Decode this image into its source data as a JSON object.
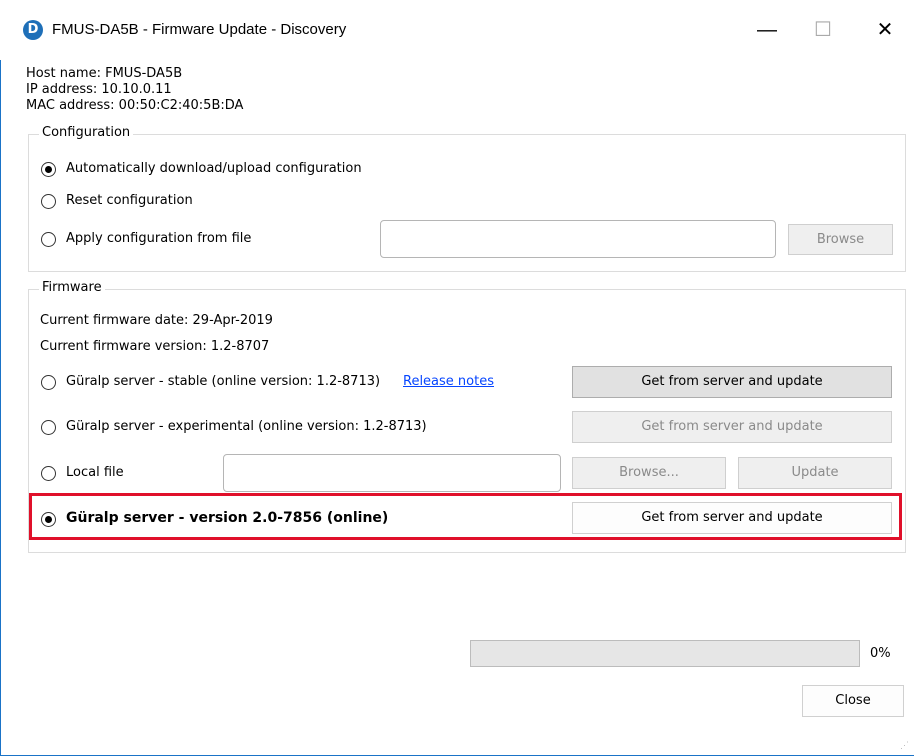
{
  "window": {
    "app_icon_letter": "D",
    "title": "FMUS-DA5B - Firmware Update - Discovery",
    "minimize": "—",
    "maximize": "☐",
    "close": "✕"
  },
  "host": {
    "host_name": "Host name:  FMUS-DA5B",
    "ip_address": "IP address:  10.10.0.11",
    "mac_address": "MAC address:  00:50:C2:40:5B:DA"
  },
  "configuration": {
    "legend": "Configuration",
    "options": [
      {
        "label": "Automatically download/upload configuration",
        "selected": true
      },
      {
        "label": "Reset configuration",
        "selected": false
      },
      {
        "label": "Apply configuration from file",
        "selected": false
      }
    ],
    "file_path": "",
    "browse_label": "Browse"
  },
  "firmware": {
    "legend": "Firmware",
    "current_date": "Current firmware date: 29-Apr-2019",
    "current_version": "Current firmware version: 1.2-8707",
    "stable": {
      "label": "Güralp server - stable (online version: 1.2-8713)",
      "release_notes": "Release notes",
      "button": "Get from server and update"
    },
    "experimental": {
      "label": "Güralp server - experimental (online version: 1.2-8713)",
      "button": "Get from server and update"
    },
    "local": {
      "label": "Local file",
      "file_path": "",
      "browse_button": "Browse...",
      "update_button": "Update"
    },
    "online": {
      "label": "Güralp server - version 2.0-7856 (online)",
      "button": "Get from server and update",
      "selected": true
    }
  },
  "progress": {
    "value_percent": 0,
    "label": "0%"
  },
  "close_button": "Close",
  "colors": {
    "highlight": "#e0102a",
    "link": "#0645ff",
    "window_border": "#1a73c7"
  }
}
